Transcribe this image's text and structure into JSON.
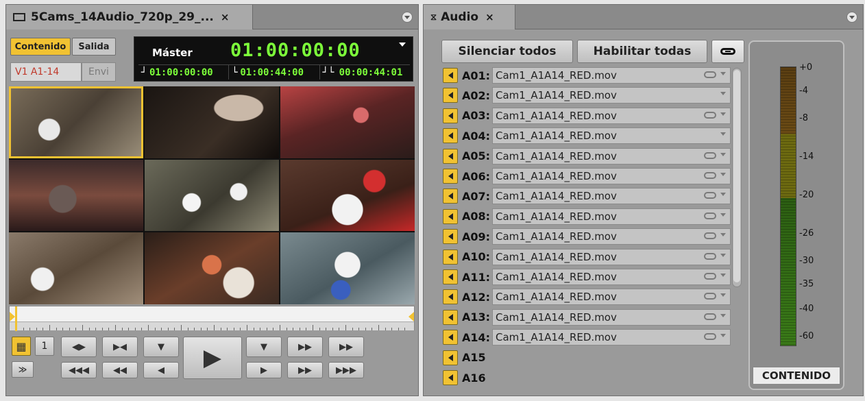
{
  "left_panel": {
    "tab_title": "5Cams_14Audio_720p_29_...",
    "tab_close": "×",
    "source_button": "Contenido",
    "record_button": "Salida",
    "tracks": "V1 A1-14",
    "envi_button": "Envi",
    "timecode": {
      "label": "Máster",
      "main": "01:00:00:00",
      "mark_in": "01:00:00:00",
      "mark_out": "01:00:44:00",
      "duration": "00:00:44:01"
    },
    "grid_one_label": "1",
    "transport": {
      "prev_edit": "◀▶",
      "mark_in_prev": "▶◀",
      "mark_in": "▼",
      "play": "▶",
      "mark_out": "▼",
      "go_mark": "▶▶",
      "next_edit": "▶▶",
      "step_back_10": "◀◀◀",
      "step_back_2": "◀◀",
      "step_back_1": "◀",
      "step_fwd_1": "▶",
      "step_fwd_2": "▶▶",
      "step_fwd_10": "▶▶▶",
      "audio_wave": "≫"
    }
  },
  "right_panel": {
    "tab_title": "Audio",
    "tab_close": "×",
    "mute_all": "Silenciar todos",
    "enable_all": "Habilitar todas",
    "meter_label": "CONTENIDO",
    "meter_scale": [
      "+0",
      "-4",
      "-8",
      "-14",
      "-20",
      "-26",
      "-30",
      "-35",
      "-40",
      "-60"
    ],
    "tracks": [
      {
        "id": "A01:",
        "clip": "Cam1_A1A14_RED.mov",
        "linked": true
      },
      {
        "id": "A02:",
        "clip": "Cam1_A1A14_RED.mov",
        "linked": false
      },
      {
        "id": "A03:",
        "clip": "Cam1_A1A14_RED.mov",
        "linked": true
      },
      {
        "id": "A04:",
        "clip": "Cam1_A1A14_RED.mov",
        "linked": false
      },
      {
        "id": "A05:",
        "clip": "Cam1_A1A14_RED.mov",
        "linked": true
      },
      {
        "id": "A06:",
        "clip": "Cam1_A1A14_RED.mov",
        "linked": true
      },
      {
        "id": "A07:",
        "clip": "Cam1_A1A14_RED.mov",
        "linked": true
      },
      {
        "id": "A08:",
        "clip": "Cam1_A1A14_RED.mov",
        "linked": true
      },
      {
        "id": "A09:",
        "clip": "Cam1_A1A14_RED.mov",
        "linked": true
      },
      {
        "id": "A10:",
        "clip": "Cam1_A1A14_RED.mov",
        "linked": true
      },
      {
        "id": "A11:",
        "clip": "Cam1_A1A14_RED.mov",
        "linked": true
      },
      {
        "id": "A12:",
        "clip": "Cam1_A1A14_RED.mov",
        "linked": true
      },
      {
        "id": "A13:",
        "clip": "Cam1_A1A14_RED.mov",
        "linked": true
      },
      {
        "id": "A14:",
        "clip": "Cam1_A1A14_RED.mov",
        "linked": true
      },
      {
        "id": "A15",
        "clip": "",
        "linked": false
      },
      {
        "id": "A16",
        "clip": "",
        "linked": false
      }
    ]
  },
  "colors": {
    "accent": "#f1c232",
    "timecode_green": "#7dff3a",
    "track_red": "#c0392b"
  }
}
